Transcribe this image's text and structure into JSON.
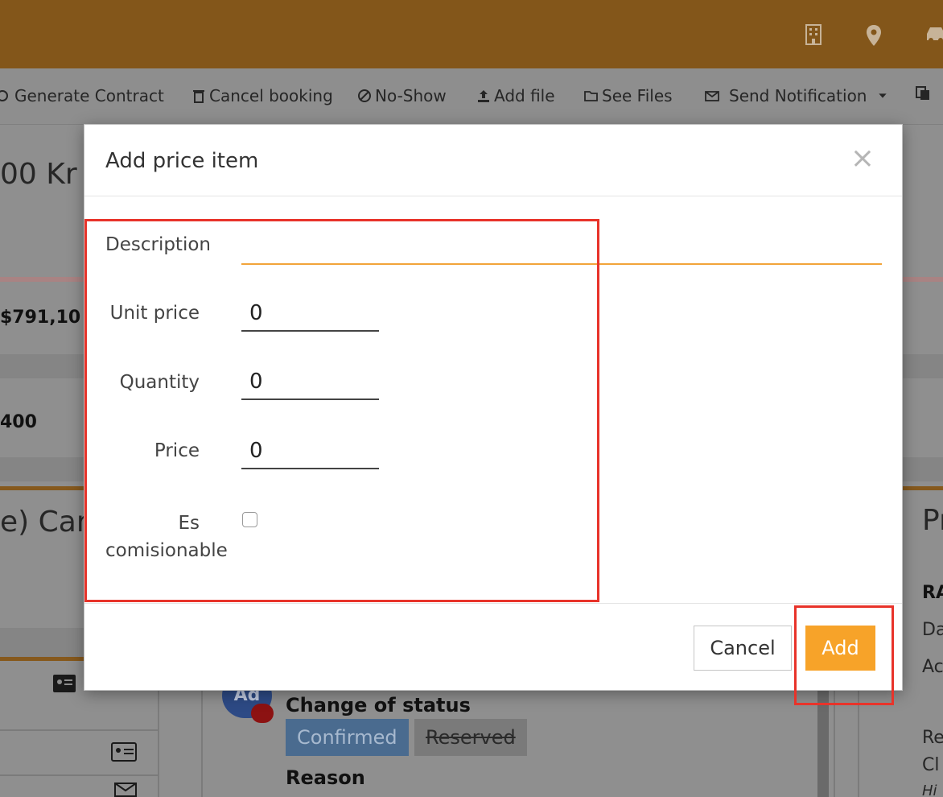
{
  "toolbar": {
    "items": [
      {
        "label": "Generate Contract",
        "icon": "contract-icon"
      },
      {
        "label": "Cancel booking",
        "icon": "trash-icon"
      },
      {
        "label": "No-Show",
        "icon": "ban-icon"
      },
      {
        "label": "Add file",
        "icon": "upload-icon"
      },
      {
        "label": "See Files",
        "icon": "folder-open-icon"
      },
      {
        "label": "Send Notification",
        "icon": "envelope-icon"
      }
    ]
  },
  "background": {
    "heading_fragment": "00 Kr",
    "amount_1": "$791,10",
    "amount_2": "400",
    "section_fragment": "e) Carg",
    "right_heading_fragment": "Pr",
    "right_bold_fragment": "RA",
    "right_line_1": "Da",
    "right_line_2": "Ac",
    "right_line_3": "Re",
    "right_line_4": "Cl",
    "right_line_5": "Hi",
    "avatar_initials": "Ad",
    "timeline": {
      "title": "Change of status",
      "status_new": "Confirmed",
      "status_old": "Reserved",
      "reason_label": "Reason"
    }
  },
  "modal": {
    "title": "Add price item",
    "close_glyph": "×",
    "fields": {
      "description_label": "Description",
      "description_value": "",
      "unit_price_label": "Unit price",
      "unit_price_value": "0",
      "quantity_label": "Quantity",
      "quantity_value": "0",
      "price_label": "Price",
      "price_value": "0",
      "commission_label_line1": "Es",
      "commission_label_line2": "comisionable",
      "commission_checked": false
    },
    "buttons": {
      "cancel": "Cancel",
      "add": "Add"
    }
  },
  "colors": {
    "topbar": "#83561a",
    "accent": "#f7a329",
    "description_underline": "#f2a43a",
    "annotation": "#e8332a"
  }
}
